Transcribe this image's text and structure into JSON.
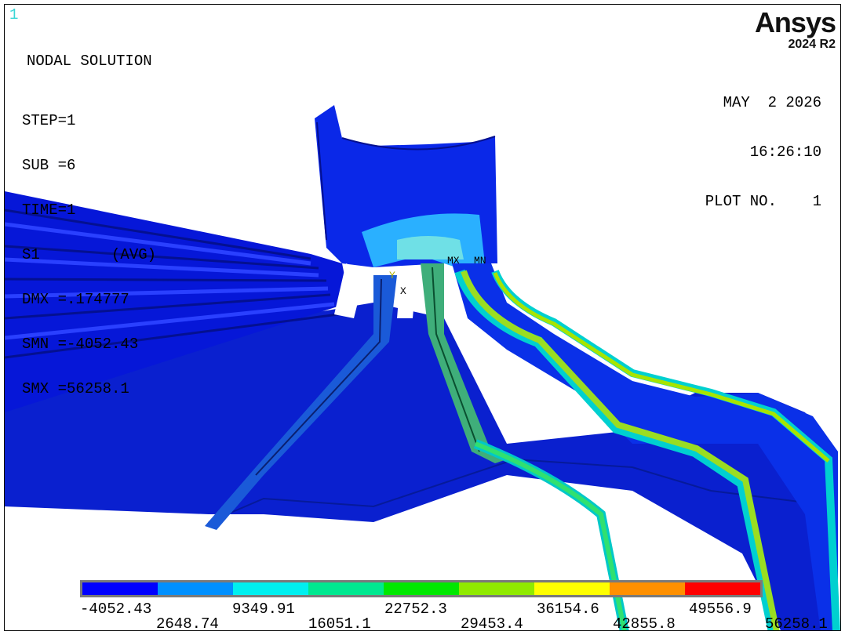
{
  "window": {
    "number": "1"
  },
  "logo": {
    "name": "Ansys",
    "release": "2024 R2"
  },
  "solution": {
    "title": "NODAL SOLUTION",
    "lines": [
      "STEP=1",
      "SUB =6",
      "TIME=1",
      "S1        (AVG)",
      "DMX =.174777",
      "SMN =-4052.43",
      "SMX =56258.1"
    ]
  },
  "plot_info": {
    "date": "MAY  2 2026",
    "time": "16:26:10",
    "plot_no": "PLOT NO.    1"
  },
  "markers": {
    "max": "MX",
    "min": "MN",
    "y_axis": "Y",
    "x_axis": "X"
  },
  "legend": {
    "colors": [
      "#0000ff",
      "#0090ff",
      "#00f0f0",
      "#00e890",
      "#00e800",
      "#90ea00",
      "#ffff00",
      "#ff9000",
      "#ff0000"
    ],
    "upper_labels": [
      "-4052.43",
      "9349.91",
      "22752.3",
      "36154.6",
      "49556.9"
    ],
    "lower_labels": [
      "2648.74",
      "16051.1",
      "29453.4",
      "42855.8",
      "56258.1"
    ]
  }
}
